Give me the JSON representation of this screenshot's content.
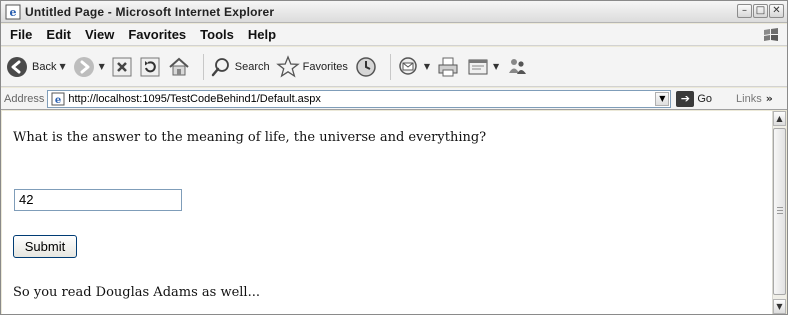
{
  "window": {
    "title": "Untitled Page - Microsoft Internet Explorer",
    "controls": {
      "minimize": "–",
      "maximize": "□",
      "close": "✕"
    }
  },
  "menubar": {
    "items": [
      "File",
      "Edit",
      "View",
      "Favorites",
      "Tools",
      "Help"
    ]
  },
  "toolbar": {
    "back_label": "Back",
    "search_label": "Search",
    "favorites_label": "Favorites"
  },
  "addressbar": {
    "label": "Address",
    "url": "http://localhost:1095/TestCodeBehind1/Default.aspx",
    "go_label": "Go",
    "links_label": "Links",
    "links_chevron": "»"
  },
  "page": {
    "question": "What is the answer to the meaning of life, the universe and everything?",
    "answer_value": "42",
    "submit_label": "Submit",
    "result": "So you read Douglas Adams as well..."
  },
  "icons": {
    "title": "ie-page-icon",
    "back": "back-arrow-icon",
    "forward": "forward-arrow-icon",
    "stop": "stop-icon",
    "refresh": "refresh-icon",
    "home": "home-icon",
    "search": "search-icon",
    "favorites": "favorites-star-icon",
    "history": "history-icon",
    "mail": "mail-icon",
    "print": "print-icon",
    "edit": "edit-icon",
    "messenger": "messenger-icon"
  }
}
